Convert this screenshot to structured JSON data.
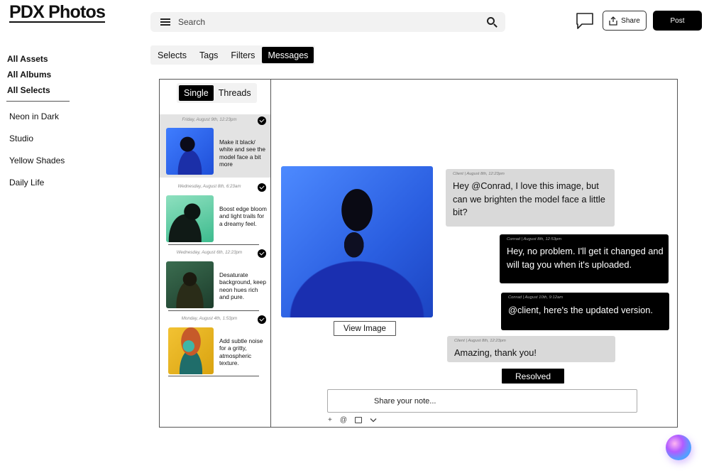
{
  "app": {
    "title": "PDX Photos"
  },
  "search": {
    "placeholder": "Search"
  },
  "header": {
    "share_label": "Share",
    "post_label": "Post"
  },
  "tabs": [
    {
      "label": "Selects",
      "active": false
    },
    {
      "label": "Tags",
      "active": false
    },
    {
      "label": "Filters",
      "active": false
    },
    {
      "label": "Messages",
      "active": true
    }
  ],
  "sidebar": {
    "main": [
      "All Assets",
      "All Albums",
      "All Selects"
    ],
    "albums": [
      "Neon in Dark",
      "Studio",
      "Yellow Shades",
      "Daily Life"
    ]
  },
  "view_toggle": {
    "single": "Single",
    "threads": "Threads",
    "active": "Single"
  },
  "threads": [
    {
      "date": "Friday, August 9th, 12:23pm",
      "text": "Make it black/ white and see the model face a bit more",
      "checked": true,
      "selected": true
    },
    {
      "date": "Wednesday, August 8th, 6:23am",
      "text": "Boost edge bloom and light trails for a dreamy feel.",
      "checked": true,
      "selected": false
    },
    {
      "date": "Wednesday, August 6th, 12:23pm",
      "text": "Desaturate background, keep neon hues rich and pure.",
      "checked": true,
      "selected": false
    },
    {
      "date": "Monday, August 4th, 1:53pm",
      "text": "Add subtle noise for a gritty, atmospheric texture.",
      "checked": true,
      "selected": false
    }
  ],
  "viewer": {
    "view_image_label": "View Image"
  },
  "messages": [
    {
      "meta": "Client | August 8th, 12:23pm",
      "text": "Hey @Conrad, I love this image, but can we brighten the model face a little bit?",
      "from": "client"
    },
    {
      "meta": "Conrad | August 8th, 12:53pm",
      "text": "Hey, no problem. I'll get it changed and will tag you when it's uploaded.",
      "from": "conrad"
    },
    {
      "meta": "Conrad | August 10th, 9:12am",
      "text": "@client, here's the updated version.",
      "from": "conrad"
    },
    {
      "meta": "Client | August 8th, 12:23pm",
      "text": "Amazing, thank you!",
      "from": "client"
    }
  ],
  "resolved_label": "Resolved",
  "composer": {
    "placeholder": "Share your note...",
    "tools": [
      "+",
      "@"
    ]
  },
  "colors": {
    "accent_dark": "#000000",
    "client_bubble": "#d9d9d9",
    "photo_blue": "#2f5fd0"
  },
  "icons": [
    "menu-icon",
    "search-icon",
    "chat-icon",
    "share-icon",
    "check-icon",
    "image-icon",
    "chevron-down-icon",
    "ai-assistant-orb"
  ]
}
